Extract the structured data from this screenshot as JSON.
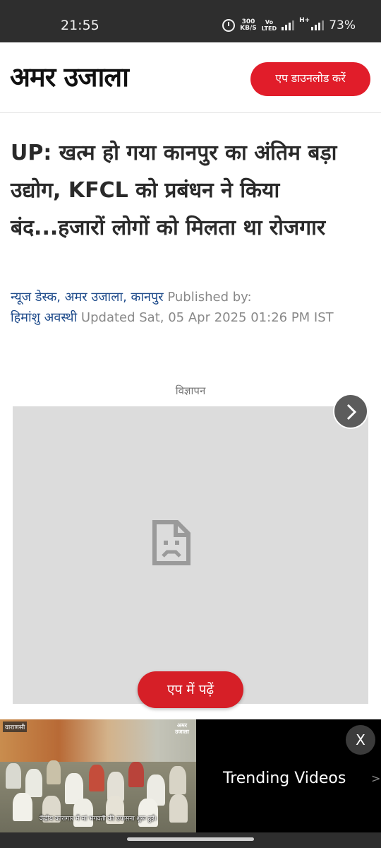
{
  "status_bar": {
    "time": "21:55",
    "net_speed_value": "300",
    "net_speed_unit": "KB/S",
    "volte_top": "Vo",
    "volte_bottom": "LTED",
    "network_type": "H+",
    "battery": "73%"
  },
  "header": {
    "logo_text": "अमर उजाला",
    "app_download_label": "एप डाउनलोड करें",
    "accent_color": "#e11d2a"
  },
  "article": {
    "headline": "UP: खत्म हो गया कानपुर का अंतिम बड़ा उद्योग, KFCL को प्रबंधन ने किया बंद...हजारों लोगों को मिलता था रोजगार",
    "author_line_1": "न्यूज डेस्क, अमर उजाला, कानपुर",
    "published_by_label": "Published by:",
    "author_line_2": "हिमांशु अवस्थी",
    "updated_text": "Updated Sat, 05 Apr 2025 01:26 PM IST"
  },
  "ad": {
    "label": "विज्ञापन"
  },
  "read_in_app_label": "एप में पढ़ें",
  "video": {
    "city_tag": "वाराणसी",
    "logo_line_1": "अमर",
    "logo_line_2": "उजाला",
    "caption": "केंद्रीय कारागार में मां भगवती की उपासना शुरू हुई।",
    "close_label": "X",
    "trending_label": "Trending Videos",
    "next_arrow": ">"
  }
}
